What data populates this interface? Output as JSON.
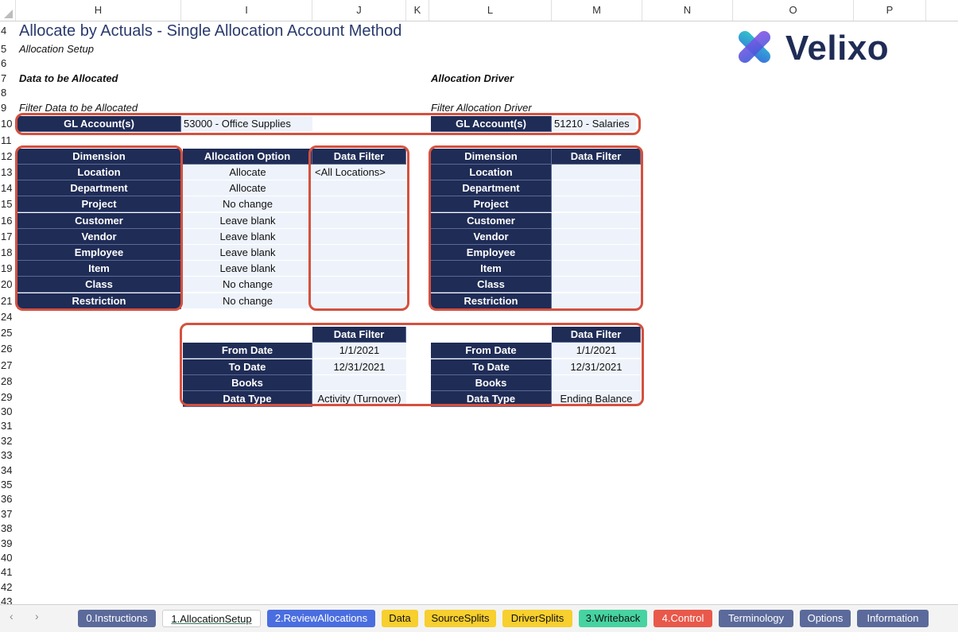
{
  "columns": [
    "H",
    "I",
    "J",
    "K",
    "L",
    "M",
    "N",
    "O",
    "P"
  ],
  "rows": [
    "4",
    "5",
    "6",
    "7",
    "8",
    "9",
    "10",
    "11",
    "12",
    "13",
    "14",
    "15",
    "16",
    "17",
    "18",
    "19",
    "20",
    "21",
    "24",
    "25",
    "26",
    "27",
    "28",
    "29",
    "30",
    "31",
    "32",
    "33",
    "34",
    "35",
    "36",
    "37",
    "38",
    "39",
    "40",
    "41",
    "42",
    "43"
  ],
  "title": "Allocate by Actuals - Single Allocation Account Method",
  "subtitle": "Allocation Setup",
  "logo_text": "Velixo",
  "section_left": "Data to be Allocated",
  "section_right": "Allocation Driver",
  "filter_left": "Filter Data to be Allocated",
  "filter_right": "Filter Allocation Driver",
  "gl_label": "GL Account(s)",
  "gl_left_value": "53000 - Office Supplies",
  "gl_right_value": "51210 - Salaries",
  "headers": {
    "dimension": "Dimension",
    "allocation_option": "Allocation Option",
    "data_filter": "Data Filter"
  },
  "dimensions": [
    "Location",
    "Department",
    "Project",
    "Customer",
    "Vendor",
    "Employee",
    "Item",
    "Class",
    "Restriction"
  ],
  "allocation_options": [
    "Allocate",
    "Allocate",
    "No change",
    "Leave blank",
    "Leave blank",
    "Leave blank",
    "Leave blank",
    "No change",
    "No change"
  ],
  "left_filters": [
    "<All Locations>",
    "",
    "",
    "",
    "",
    "",
    "",
    "",
    ""
  ],
  "right_filters": [
    "",
    "",
    "",
    "",
    "",
    "",
    "",
    "",
    ""
  ],
  "date_labels": [
    "From Date",
    "To Date",
    "Books",
    "Data Type"
  ],
  "left_date_values": [
    "1/1/2021",
    "12/31/2021",
    "",
    "Activity (Turnover)"
  ],
  "right_date_values": [
    "1/1/2021",
    "12/31/2021",
    "",
    "Ending Balance"
  ],
  "tabs": [
    {
      "label": "0.Instructions",
      "color": "#5b6a9a",
      "text": "#ffffff"
    },
    {
      "label": "1.AllocationSetup",
      "color": "#ffffff",
      "text": "#111111"
    },
    {
      "label": "2.ReviewAllocations",
      "color": "#4a6ee0",
      "text": "#ffffff"
    },
    {
      "label": "Data",
      "color": "#f7cf2e",
      "text": "#111111"
    },
    {
      "label": "SourceSplits",
      "color": "#f7cf2e",
      "text": "#111111"
    },
    {
      "label": "DriverSplits",
      "color": "#f7cf2e",
      "text": "#111111"
    },
    {
      "label": "3.Writeback",
      "color": "#46d3a1",
      "text": "#111111"
    },
    {
      "label": "4.Control",
      "color": "#e8594b",
      "text": "#ffffff"
    },
    {
      "label": "Terminology",
      "color": "#5b6a9a",
      "text": "#ffffff"
    },
    {
      "label": "Options",
      "color": "#5b6a9a",
      "text": "#ffffff"
    },
    {
      "label": "Information",
      "color": "#5b6a9a",
      "text": "#ffffff"
    }
  ],
  "nav": {
    "prev": "‹",
    "next": "›"
  },
  "colors": {
    "header": "#1f2c56",
    "value_fill": "#eef3fb",
    "outline": "#d4513f",
    "title": "#2a3a6e"
  }
}
